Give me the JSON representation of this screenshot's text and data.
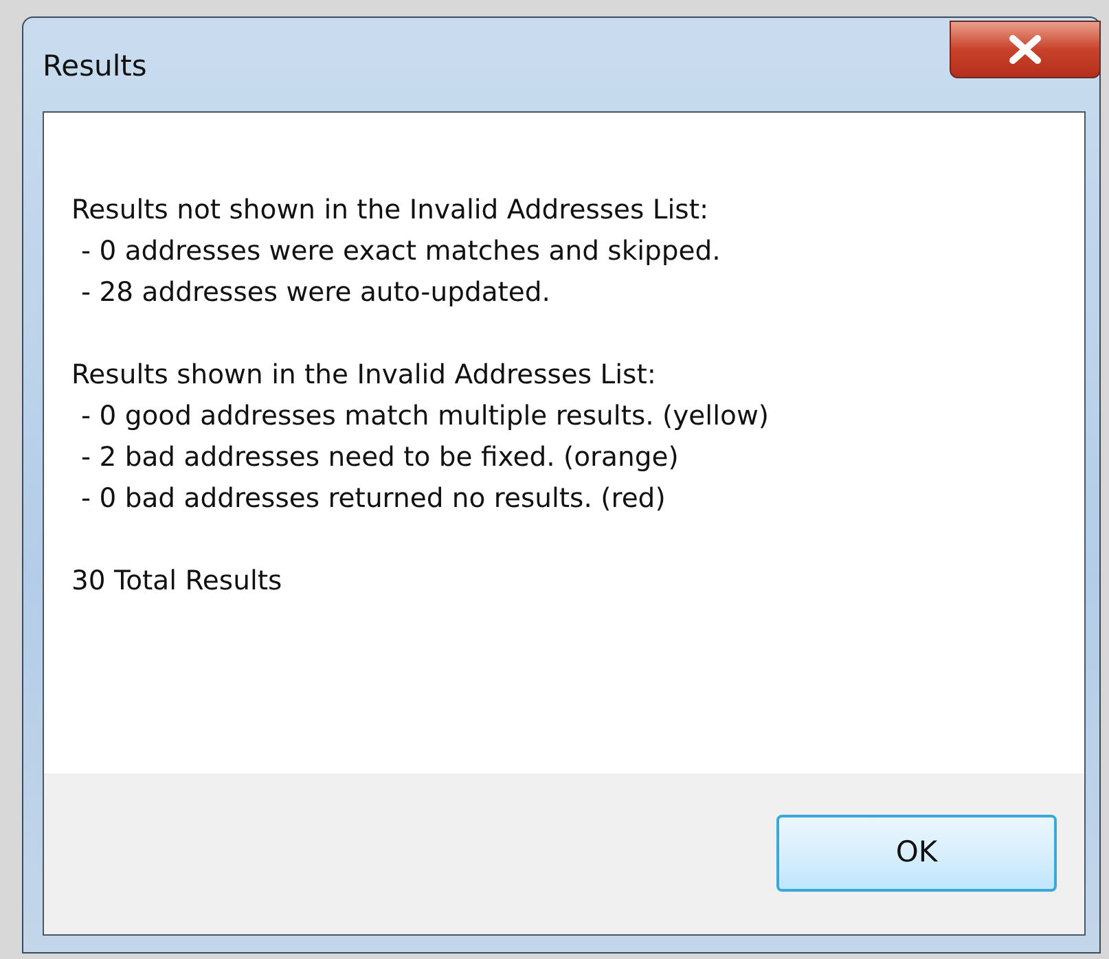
{
  "window": {
    "title": "Results"
  },
  "sections": [
    {
      "heading": "Results not shown in the Invalid Addresses List:",
      "items": [
        "- 0 addresses were exact matches and skipped.",
        "- 28 addresses were auto-updated."
      ]
    },
    {
      "heading": "Results shown in the Invalid Addresses List:",
      "items": [
        "- 0 good addresses match multiple results. (yellow)",
        "- 2 bad addresses need to be fixed. (orange)",
        "- 0 bad addresses returned no results. (red)"
      ]
    }
  ],
  "total": "30 Total Results",
  "buttons": [
    "OK"
  ]
}
